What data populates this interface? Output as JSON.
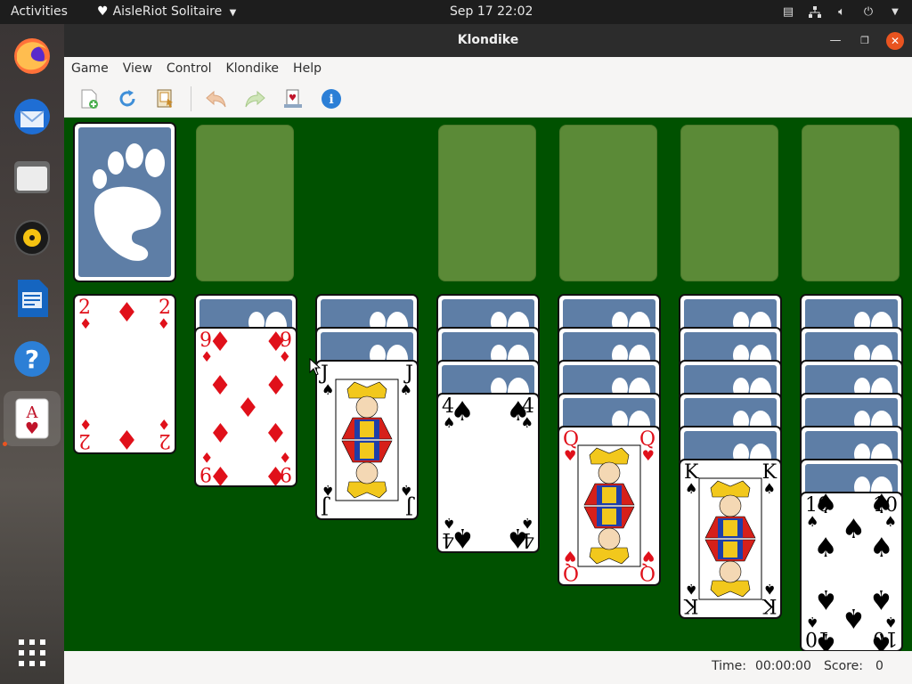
{
  "topbar": {
    "activities": "Activities",
    "app_menu": "AisleRiot Solitaire",
    "clock": "Sep 17  22:02"
  },
  "dock": {
    "apps": [
      {
        "name": "Firefox Web Browser",
        "icon": "firefox-icon"
      },
      {
        "name": "Thunderbird Mail",
        "icon": "thunderbird-icon"
      },
      {
        "name": "Files",
        "icon": "files-icon"
      },
      {
        "name": "Rhythmbox",
        "icon": "rhythmbox-icon"
      },
      {
        "name": "LibreOffice Writer",
        "icon": "writer-icon"
      },
      {
        "name": "Help",
        "icon": "help-icon"
      },
      {
        "name": "AisleRiot Solitaire",
        "icon": "solitaire-icon",
        "active": true
      }
    ],
    "show_apps": "show-applications-icon"
  },
  "window": {
    "title": "Klondike",
    "menus": [
      "Game",
      "View",
      "Control",
      "Klondike",
      "Help"
    ],
    "toolbar": [
      "new-game-icon",
      "restart-icon",
      "select-game-icon",
      "undo-icon",
      "redo-icon",
      "deal-icon",
      "hint-icon"
    ]
  },
  "tableau": [
    {
      "face_down": 0,
      "top": {
        "rank": "2",
        "suit": "♦",
        "color": "red"
      }
    },
    {
      "face_down": 1,
      "top": {
        "rank": "9",
        "suit": "♦",
        "color": "red"
      }
    },
    {
      "face_down": 2,
      "top": {
        "rank": "J",
        "suit": "♠",
        "color": "black"
      }
    },
    {
      "face_down": 3,
      "top": {
        "rank": "4",
        "suit": "♠",
        "color": "black"
      }
    },
    {
      "face_down": 4,
      "top": {
        "rank": "Q",
        "suit": "♥",
        "color": "red"
      }
    },
    {
      "face_down": 5,
      "top": {
        "rank": "K",
        "suit": "♠",
        "color": "black"
      }
    },
    {
      "face_down": 6,
      "top": {
        "rank": "10",
        "suit": "♠",
        "color": "black"
      }
    }
  ],
  "status": {
    "time_label": "Time:",
    "time_value": "00:00:00",
    "score_label": "Score:",
    "score_value": "0"
  },
  "colors": {
    "felt": "#005100",
    "slot": "#5b8a37",
    "card_back": "#5e7ea6",
    "accent": "#e95420"
  }
}
